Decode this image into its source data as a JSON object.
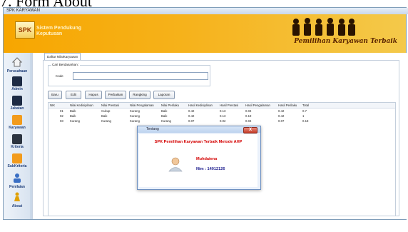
{
  "caption": "7. Form About",
  "window": {
    "title": "SPK KARYAWAN"
  },
  "banner": {
    "logo_text": "SPK",
    "logo_sub_line1": "Sistem Pendukung",
    "logo_sub_line2": "Keputusan",
    "slogan": "Pemilihan Karyawan Terbaik"
  },
  "sidebar": {
    "items": [
      {
        "label": "Perusahaan",
        "icon": "home-icon"
      },
      {
        "label": "Admin",
        "icon": "admin-icon"
      },
      {
        "label": "Jabatan",
        "icon": "jabatan-icon"
      },
      {
        "label": "Karyawan",
        "icon": "karyawan-icon"
      },
      {
        "label": "Kriteria",
        "icon": "kriteria-icon"
      },
      {
        "label": "SubKriteria",
        "icon": "subkriteria-icon"
      },
      {
        "label": "Penilaian",
        "icon": "penilaian-icon"
      },
      {
        "label": "About",
        "icon": "about-icon"
      }
    ]
  },
  "main": {
    "tab": "Daftar NilaiKaryawan",
    "search_group": "Cari Berdasarkan :",
    "search_field_label": "Kode",
    "search_value": "",
    "buttons": [
      "Baru",
      "Edit",
      "Hapus",
      "Perbaikan",
      "Rangking",
      "Laporan"
    ],
    "table": {
      "columns": [
        "NIK",
        "Nilai Kedisiplinan",
        "Nilai Prestasi",
        "Nilai Pengalaman",
        "Nilai Perilaku",
        "Hasil Kedisiplinan",
        "Hasil Prestasi",
        "Hasil Pengalaman",
        "Hasil Perilaku",
        "Total"
      ],
      "rows": [
        [
          "01",
          "Baik",
          "Cukup",
          "Kurang",
          "Baik",
          "0.42",
          "0.13",
          "0.04",
          "0.42",
          "0.7"
        ],
        [
          "02",
          "Baik",
          "Baik",
          "Kurang",
          "Baik",
          "0.42",
          "0.13",
          "0.19",
          "0.42",
          "1"
        ],
        [
          "03",
          "Kurang",
          "Kurang",
          "Kurang",
          "Kurang",
          "0.07",
          "0.02",
          "0.04",
          "0.07",
          "0.18"
        ]
      ]
    }
  },
  "dialog": {
    "title": "Tentang",
    "close": "X",
    "heading": "SPK Pemilihan Karyawan Terbaik Metode AHP",
    "name": "Muhdaiena",
    "nim": "Nim : 14012126"
  },
  "colors": {
    "accent_orange": "#f6b21b",
    "dialog_red": "#d40000"
  }
}
